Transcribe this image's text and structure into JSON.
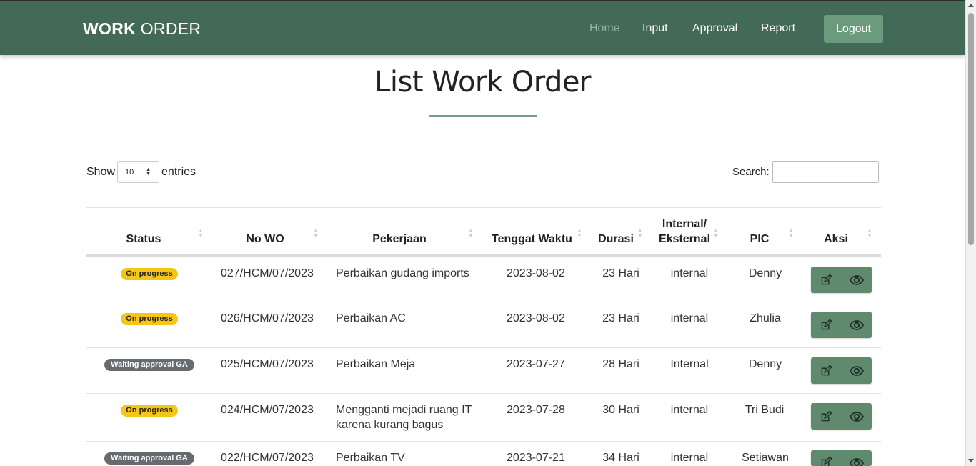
{
  "brand": {
    "part1": "WORK",
    "part2": " ORDER"
  },
  "nav": {
    "home": "Home",
    "input": "Input",
    "approval": "Approval",
    "report": "Report",
    "logout": "Logout"
  },
  "page": {
    "title": "List Work Order"
  },
  "controls": {
    "show_label": "Show",
    "entries_value": "10",
    "entries_label": "entries",
    "search_label": "Search:"
  },
  "table": {
    "headers": {
      "status": "Status",
      "no_wo": "No WO",
      "pekerjaan": "Pekerjaan",
      "tenggat": "Tenggat Waktu",
      "durasi": "Durasi",
      "internal1": "Internal/",
      "internal2": "Eksternal",
      "pic": "PIC",
      "aksi": "Aksi"
    },
    "rows": [
      {
        "status": "On progress",
        "no_wo": "027/HCM/07/2023",
        "pekerjaan1": "Perbaikan gudang imports",
        "pekerjaan2": "",
        "tenggat": "2023-08-02",
        "durasi": "23 Hari",
        "type": "internal",
        "pic": "Denny"
      },
      {
        "status": "On progress",
        "no_wo": "026/HCM/07/2023",
        "pekerjaan1": "Perbaikan AC",
        "pekerjaan2": "",
        "tenggat": "2023-08-02",
        "durasi": "23 Hari",
        "type": "internal",
        "pic": "Zhulia"
      },
      {
        "status": "Waiting approval GA",
        "no_wo": "025/HCM/07/2023",
        "pekerjaan1": "Perbaikan Meja",
        "pekerjaan2": "",
        "tenggat": "2023-07-27",
        "durasi": "28 Hari",
        "type": "Internal",
        "pic": "Denny"
      },
      {
        "status": "On progress",
        "no_wo": "024/HCM/07/2023",
        "pekerjaan1": "Mengganti mejadi ruang IT",
        "pekerjaan2": "karena kurang bagus",
        "tenggat": "2023-07-28",
        "durasi": "30 Hari",
        "type": "internal",
        "pic": "Tri Budi"
      },
      {
        "status": "Waiting approval GA",
        "no_wo": "022/HCM/07/2023",
        "pekerjaan1": "Perbaikan TV",
        "pekerjaan2": "",
        "tenggat": "2023-07-21",
        "durasi": "34 Hari",
        "type": "internal",
        "pic": "Setiawan"
      }
    ]
  },
  "colors": {
    "navbar": "#436a57",
    "accent": "#5f8a6e",
    "badge_progress": "#f5c518",
    "badge_waiting": "#666b70"
  },
  "icons": {
    "edit": "edit-icon",
    "view": "eye-icon"
  }
}
